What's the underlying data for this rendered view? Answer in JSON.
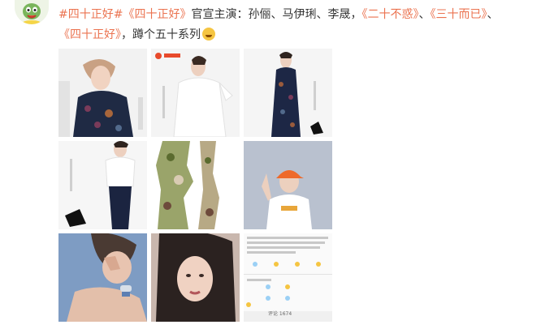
{
  "post": {
    "hashtag": "#四十正好#",
    "show_title_1": "《四十正好》",
    "lead_text": "官宣主演：孙俪、马伊琍、李晟，",
    "show_title_2": "《二十不惑》",
    "sep_1": "、",
    "show_title_3": "《三十而已》",
    "sep_2": "、",
    "show_title_4": "《四十正好》",
    "tail_text": "，蹲个五十系列",
    "emoji_icon": "laughing-tears-emoji-icon"
  },
  "images": [
    {
      "name": "photo-woman-floral-dress",
      "bg": "#f2f2f2"
    },
    {
      "name": "photo-woman-white-suit",
      "bg": "#f4f4f4"
    },
    {
      "name": "photo-woman-long-floral-dress",
      "bg": "#f5f5f5"
    },
    {
      "name": "photo-woman-white-shirt",
      "bg": "#f6f6f6"
    },
    {
      "name": "photo-torn-floral-paper",
      "bg": "#ffffff"
    },
    {
      "name": "photo-woman-orange-cap",
      "bg": "#aeb7c6"
    },
    {
      "name": "photo-woman-hand-face",
      "bg": "#7e9cc3"
    },
    {
      "name": "photo-woman-selfie",
      "bg": "#c9b7ae"
    },
    {
      "name": "photo-post-screenshot",
      "bg": "#fafafa"
    }
  ],
  "screenshot_card": {
    "comment_count_label": "评论 1674"
  },
  "colors": {
    "link": "#eb7350",
    "text": "#333333"
  }
}
